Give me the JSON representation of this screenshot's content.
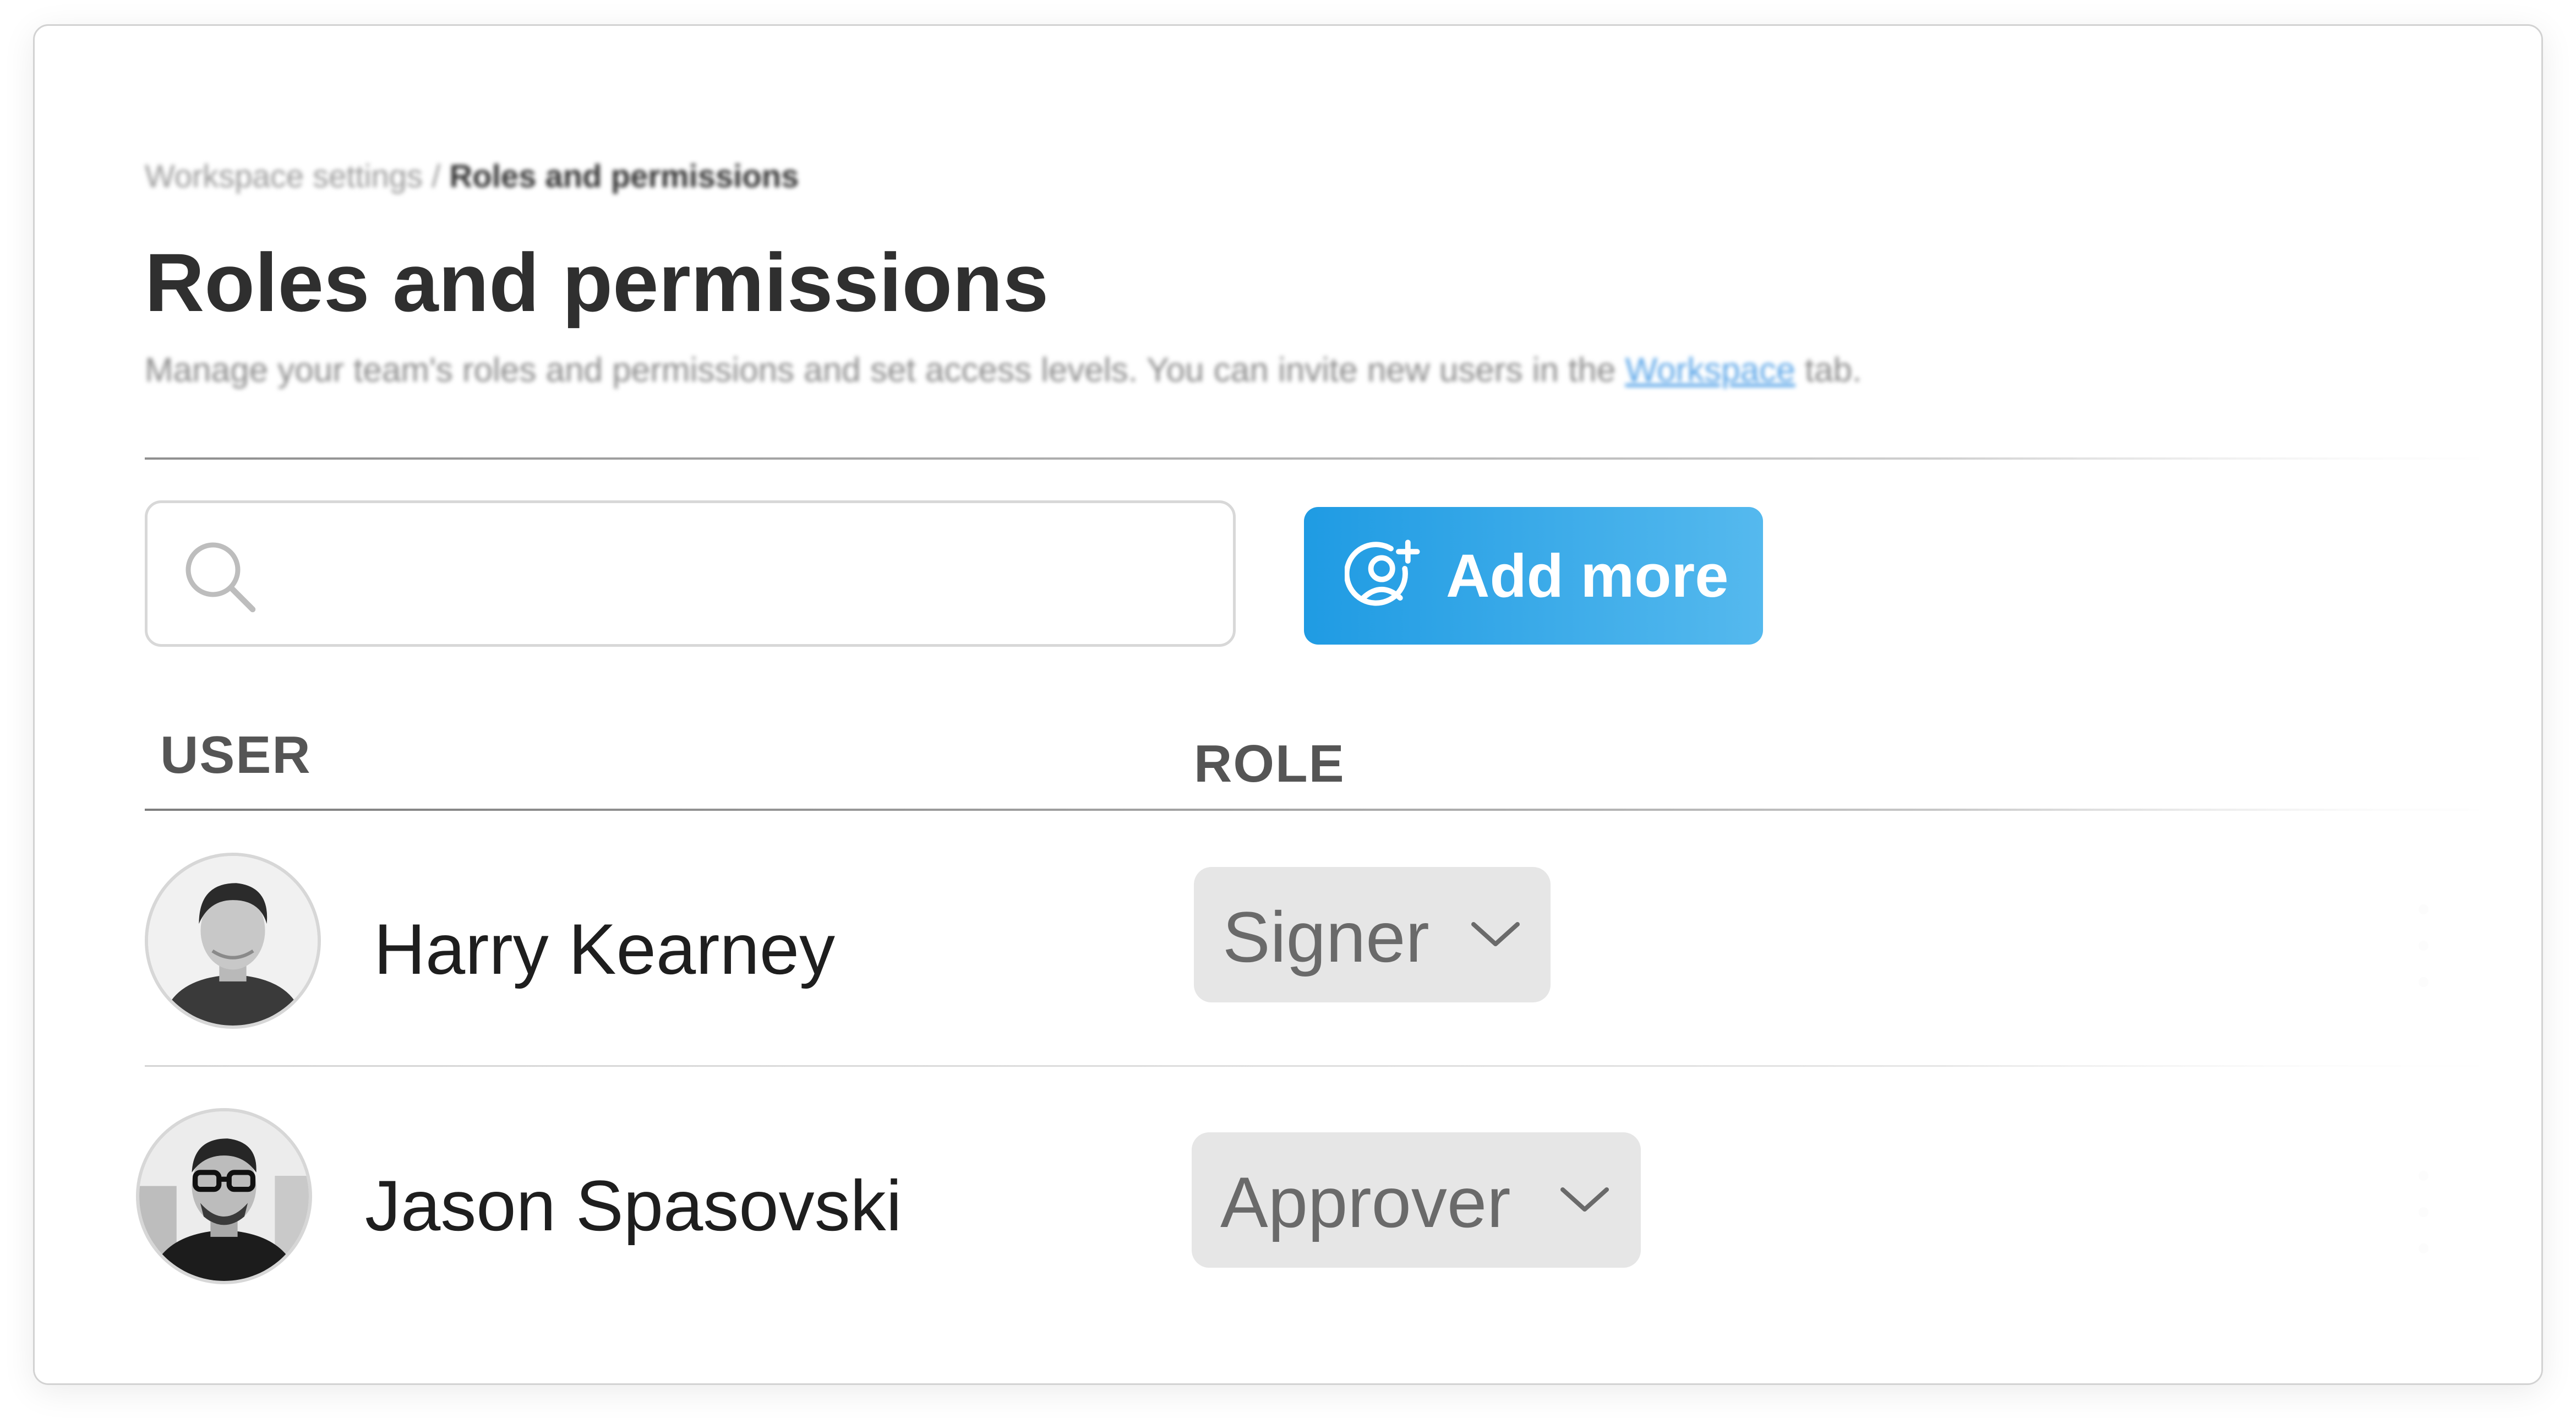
{
  "breadcrumb": {
    "parent": "Workspace settings",
    "separator": "/",
    "current": "Roles and permissions"
  },
  "page": {
    "title": "Roles and permissions",
    "description_prefix": "Manage your team's roles and permissions and set access levels. You can invite new users in the ",
    "description_link": "Workspace",
    "description_suffix": " tab."
  },
  "search": {
    "placeholder": "",
    "value": ""
  },
  "add_button": {
    "label": "Add more",
    "icon": "user-add-icon"
  },
  "table": {
    "columns": [
      "USER",
      "ROLE"
    ],
    "rows": [
      {
        "name": "Harry Kearney",
        "role": "Signer"
      },
      {
        "name": "Jason Spasovski",
        "role": "Approver"
      }
    ]
  },
  "colors": {
    "accent": "#1f9be3",
    "accent_light": "#55b9ee",
    "title": "#2f2f2f",
    "role_bg": "#e6e6e6"
  }
}
